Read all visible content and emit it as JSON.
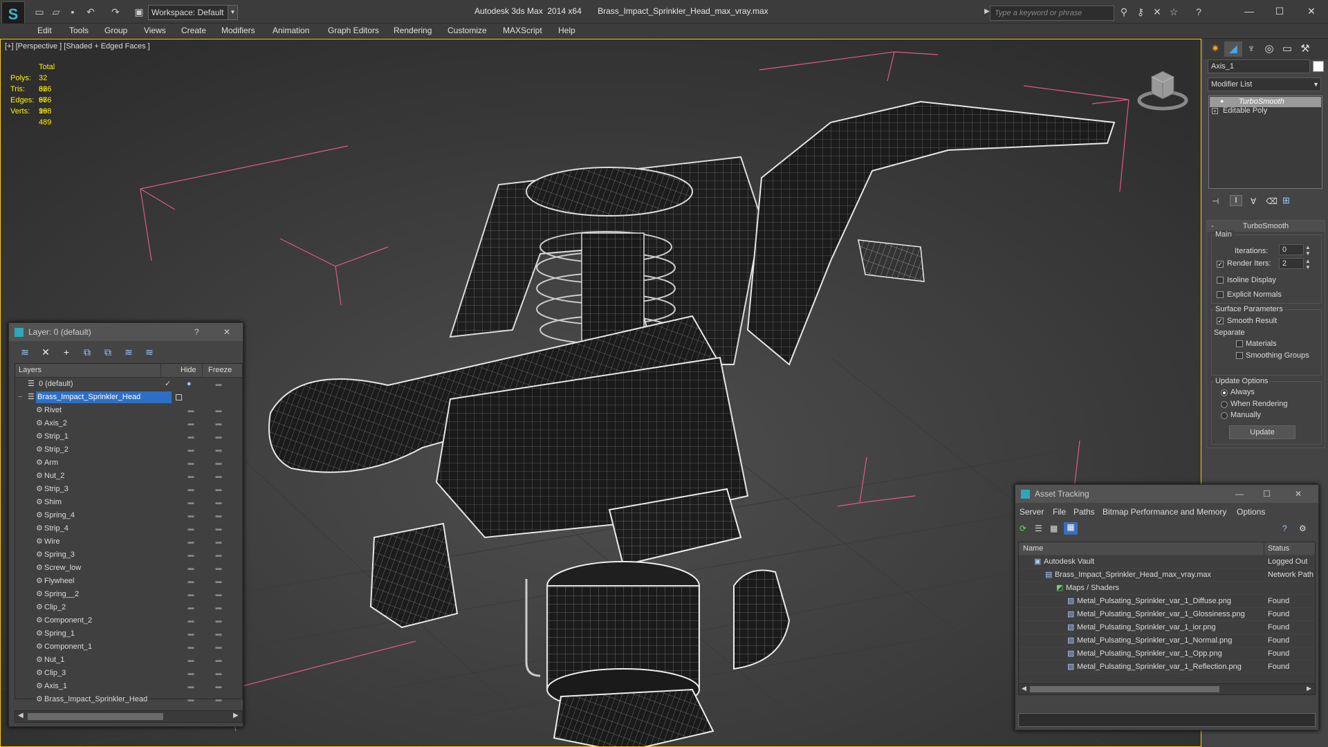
{
  "titlebar": {
    "app": "Autodesk 3ds Max  2014 x64",
    "file": "Brass_Impact_Sprinkler_Head_max_vray.max",
    "workspace": "Workspace: Default",
    "search_placeholder": "Type a keyword or phrase"
  },
  "menubar": [
    "Edit",
    "Tools",
    "Group",
    "Views",
    "Create",
    "Modifiers",
    "Animation",
    "Graph Editors",
    "Rendering",
    "Customize",
    "MAXScript",
    "Help"
  ],
  "viewport": {
    "label": "[+] [Perspective ] [Shaded + Edged Faces ]",
    "stats": {
      "header": "Total",
      "rows": [
        {
          "k": "Polys:",
          "v": "32 666"
        },
        {
          "k": "Tris:",
          "v": "32 666"
        },
        {
          "k": "Edges:",
          "v": "97 998"
        },
        {
          "k": "Verts:",
          "v": "16 489"
        }
      ]
    }
  },
  "layer_dialog": {
    "title": "Layer: 0 (default)",
    "help": "?",
    "close": "✕",
    "columns": {
      "layers": "Layers",
      "hide": "Hide",
      "freeze": "Freeze"
    },
    "default_layer": "0 (default)",
    "selected_layer": "Brass_Impact_Sprinkler_Head",
    "objects": [
      "Rivet",
      "Axis_2",
      "Strip_1",
      "Strip_2",
      "Arm",
      "Nut_2",
      "Strip_3",
      "Shim",
      "Spring_4",
      "Strip_4",
      "Wire",
      "Spring_3",
      "Screw_low",
      "Flywheel",
      "Spring__2",
      "Clip_2",
      "Component_2",
      "Spring_1",
      "Component_1",
      "Nut_1",
      "Clip_3",
      "Axis_1",
      "Brass_Impact_Sprinkler_Head"
    ]
  },
  "command_panel": {
    "object_name": "Axis_1",
    "modifier_list": "Modifier List",
    "stack": [
      "TurboSmooth",
      "Editable Poly"
    ],
    "rollout_title": "TurboSmooth",
    "main_label": "Main",
    "iterations_label": "Iterations:",
    "iterations_value": "0",
    "render_iters_label": "Render Iters:",
    "render_iters_value": "2",
    "isoline": "Isoline Display",
    "explicit_normals": "Explicit Normals",
    "surface_params": "Surface Parameters",
    "smooth_result": "Smooth Result",
    "separate": "Separate",
    "materials": "Materials",
    "smoothing_groups": "Smoothing Groups",
    "update_options": "Update Options",
    "always": "Always",
    "when_rendering": "When Rendering",
    "manually": "Manually",
    "update_btn": "Update"
  },
  "asset_tracking": {
    "title": "Asset Tracking",
    "menu": [
      "Server",
      "File",
      "Paths",
      "Bitmap Performance and Memory",
      "Options"
    ],
    "columns": {
      "name": "Name",
      "status": "Status"
    },
    "rows": [
      {
        "name": "Autodesk Vault",
        "status": "Logged Out"
      },
      {
        "name": "Brass_Impact_Sprinkler_Head_max_vray.max",
        "status": "Network Path"
      },
      {
        "name": "Maps / Shaders",
        "status": ""
      },
      {
        "name": "Metal_Pulsating_Sprinkler_var_1_Diffuse.png",
        "status": "Found"
      },
      {
        "name": "Metal_Pulsating_Sprinkler_var_1_Glossiness.png",
        "status": "Found"
      },
      {
        "name": "Metal_Pulsating_Sprinkler_var_1_ior.png",
        "status": "Found"
      },
      {
        "name": "Metal_Pulsating_Sprinkler_var_1_Normal.png",
        "status": "Found"
      },
      {
        "name": "Metal_Pulsating_Sprinkler_var_1_Opp.png",
        "status": "Found"
      },
      {
        "name": "Metal_Pulsating_Sprinkler_var_1_Reflection.png",
        "status": "Found"
      }
    ]
  }
}
